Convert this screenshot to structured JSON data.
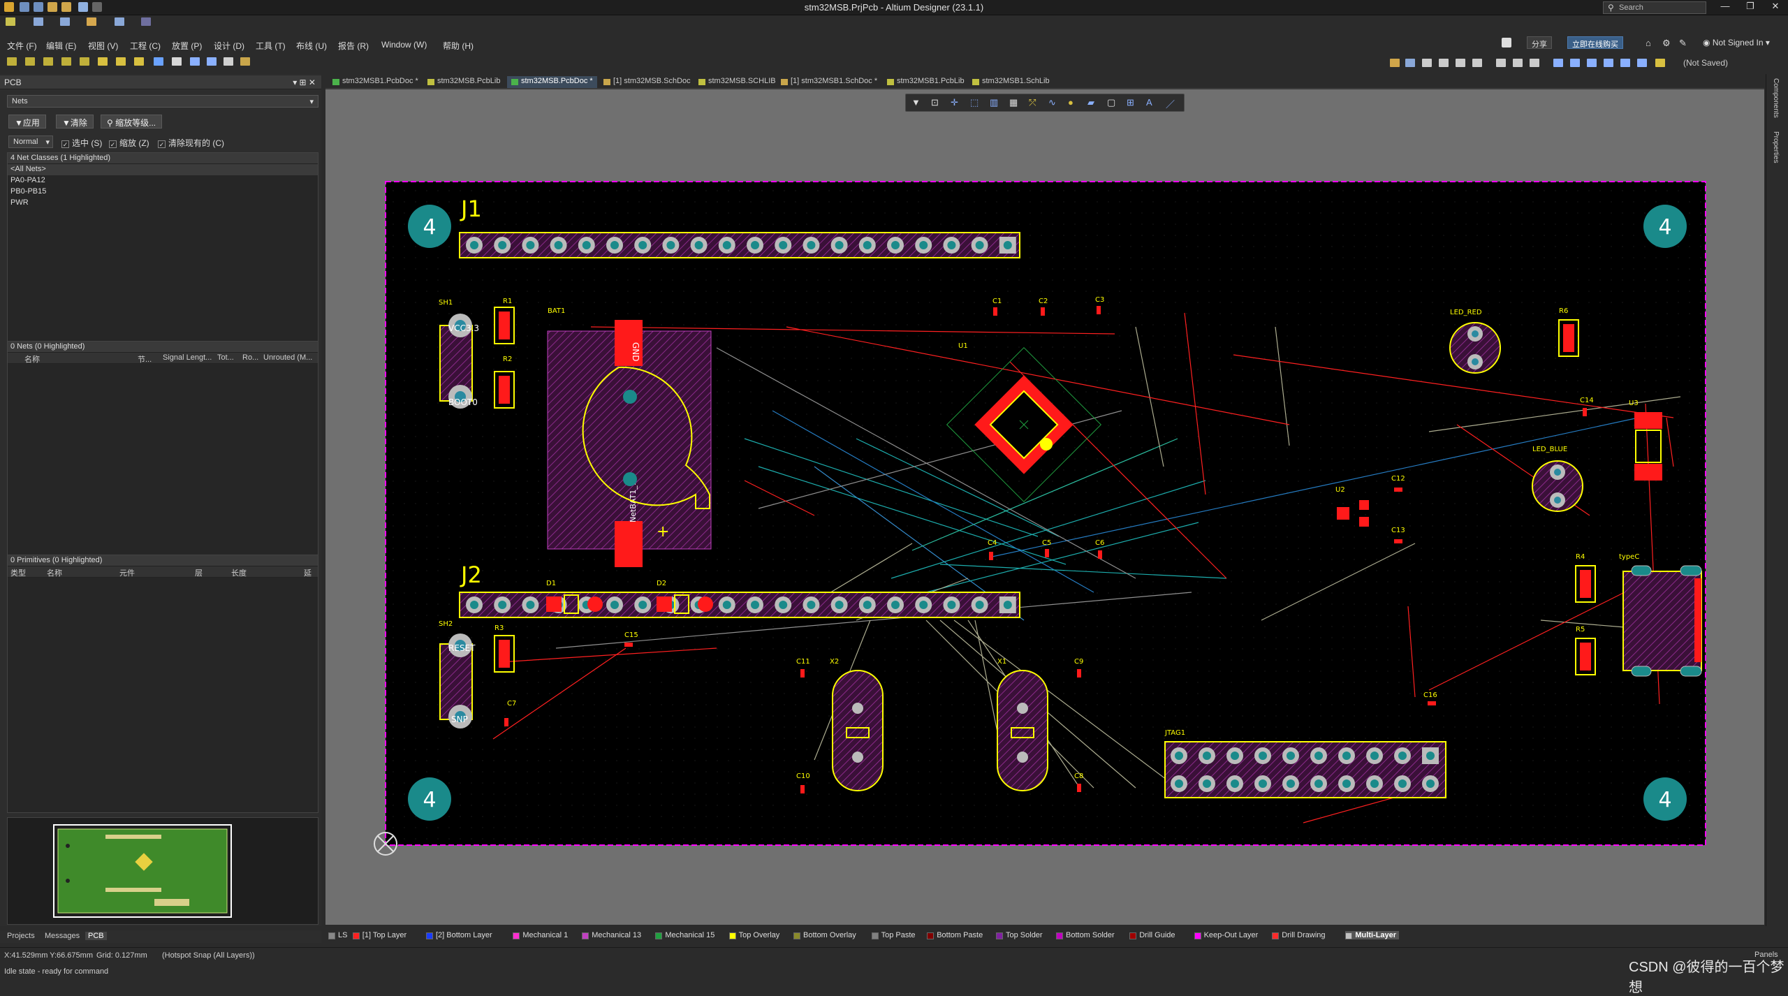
{
  "window": {
    "title": "stm32MSB.PrjPcb - Altium Designer (23.1.1)"
  },
  "search": {
    "placeholder": "Search"
  },
  "menu": {
    "items": [
      "文件 (F)",
      "编辑 (E)",
      "视图 (V)",
      "工程 (C)",
      "放置 (P)",
      "设计 (D)",
      "工具 (T)",
      "布线 (U)",
      "报告 (R)",
      "Window (W)",
      "帮助 (H)"
    ]
  },
  "account": {
    "share": "分享",
    "buy": "立即在线购买",
    "user": "Not Signed In",
    "save_state": "(Not Saved)"
  },
  "panel": {
    "title": "PCB",
    "mode_select": "Nets",
    "apply_label": "应用",
    "clear_label": "清除",
    "zoom_label": "缩放等级...",
    "normal_select": "Normal",
    "check_select": "选中 (S)",
    "check_zoom": "缩放 (Z)",
    "check_clear": "清除现有的 (C)",
    "classes_header": "4 Net Classes (1 Highlighted)",
    "classes": [
      "<All Nets>",
      "PA0-PA12",
      "PB0-PB15",
      "PWR"
    ],
    "nets_header": "0 Nets (0 Highlighted)",
    "nets_cols": [
      "名称",
      "节...",
      "Signal Lengt...",
      "Tot...",
      "Ro...",
      "Unrouted (M..."
    ],
    "prims_header": "0 Primitives (0 Highlighted)",
    "prims_cols": [
      "类型",
      "名称",
      "元件",
      "层",
      "长度",
      "延"
    ]
  },
  "bottom_tabs": [
    "Projects",
    "Messages",
    "PCB"
  ],
  "doc_tabs": [
    {
      "label": "stm32MSB1.PcbDoc *",
      "active": false
    },
    {
      "label": "stm32MSB.PcbLib",
      "active": false
    },
    {
      "label": "stm32MSB.PcbDoc *",
      "active": true
    },
    {
      "label": "[1] stm32MSB.SchDoc",
      "active": false
    },
    {
      "label": "stm32MSB.SCHLIB",
      "active": false
    },
    {
      "label": "[1] stm32MSB1.SchDoc *",
      "active": false
    },
    {
      "label": "stm32MSB1.PcbLib",
      "active": false
    },
    {
      "label": "stm32MSB1.SchLib",
      "active": false
    }
  ],
  "side_tabs": [
    "Components",
    "Properties"
  ],
  "pcb": {
    "corner_marks": [
      "4",
      "4",
      "4",
      "4"
    ],
    "headers": [
      "J1",
      "J2"
    ],
    "pad_labels": [
      "GND",
      "NetBAT1_1",
      "VCC3.3",
      "BOOT0",
      "RESET",
      "SNP"
    ],
    "designators": [
      "SH1",
      "R1",
      "R2",
      "BAT1",
      "C1",
      "C2",
      "C3",
      "U1",
      "LED_RED",
      "R6",
      "C14",
      "U3",
      "LED_BLUE",
      "C12",
      "U2",
      "C13",
      "C4",
      "C5",
      "C6",
      "D1",
      "D2",
      "C15",
      "SH2",
      "R3",
      "C7",
      "C11",
      "X2",
      "X1",
      "C9",
      "C10",
      "C8",
      "JTAG1",
      "C16",
      "R4",
      "R5",
      "typeC"
    ]
  },
  "layers": [
    {
      "label": "LS",
      "color": "#888888"
    },
    {
      "label": "[1] Top Layer",
      "color": "#ff2020"
    },
    {
      "label": "[2] Bottom Layer",
      "color": "#1a3cff"
    },
    {
      "label": "Mechanical 1",
      "color": "#ff2dd0"
    },
    {
      "label": "Mechanical 13",
      "color": "#c040c0"
    },
    {
      "label": "Mechanical 15",
      "color": "#20a040"
    },
    {
      "label": "Top Overlay",
      "color": "#ffff00"
    },
    {
      "label": "Bottom Overlay",
      "color": "#8a8a2a"
    },
    {
      "label": "Top Paste",
      "color": "#808080"
    },
    {
      "label": "Bottom Paste",
      "color": "#800000"
    },
    {
      "label": "Top Solder",
      "color": "#8020a0"
    },
    {
      "label": "Bottom Solder",
      "color": "#c000c0"
    },
    {
      "label": "Drill Guide",
      "color": "#a00000"
    },
    {
      "label": "Keep-Out Layer",
      "color": "#ff00ff"
    },
    {
      "label": "Drill Drawing",
      "color": "#ff2a2a"
    },
    {
      "label": "Multi-Layer",
      "color": "#c0c0c0"
    }
  ],
  "status": {
    "coords": "X:41.529mm Y:66.675mm",
    "grid": "Grid: 0.127mm",
    "snap": "(Hotspot Snap (All Layers))",
    "state": "Idle state - ready for command",
    "panels": "Panels"
  },
  "watermark": "CSDN @彼得的一百个梦想",
  "colors": {
    "board_outline": "#ff00ff",
    "overlay": "#ffff00",
    "pad": "#ff1a1a",
    "via": "#20a0a0",
    "bg": "#000000"
  }
}
